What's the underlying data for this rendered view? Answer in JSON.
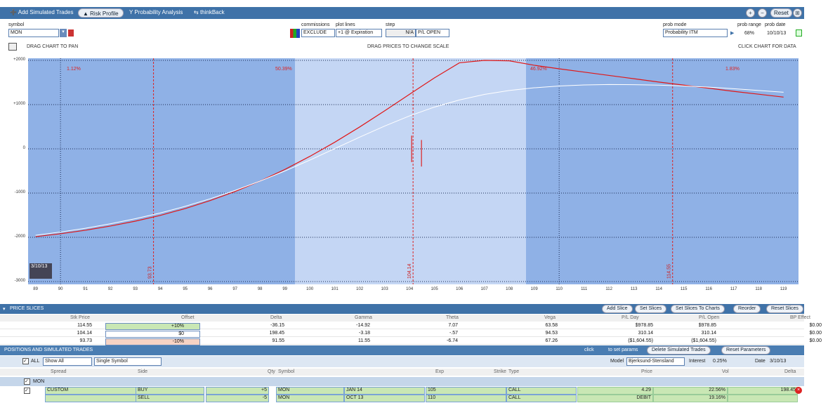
{
  "toolbar": {
    "add_simulated": "Add Simulated Trades",
    "risk_profile": "Risk Profile",
    "probability": "Probability Analysis",
    "thinkback": "thinkBack",
    "reset": "Reset"
  },
  "controls": {
    "symbol_label": "symbol",
    "symbol": "MON",
    "commissions_label": "commissions",
    "commissions": "EXCLUDE",
    "plot_lines_label": "plot lines",
    "plot_lines": "+1 @ Expiration",
    "step_label": "step",
    "step": "N/A",
    "pl_mode": "P/L OPEN",
    "prob_mode_label": "prob mode",
    "prob_mode": "Probability ITM",
    "prob_range_label": "prob range",
    "prob_range": "68%",
    "prob_date_label": "prob date",
    "prob_date": "10/10/13"
  },
  "hints": {
    "pan": "DRAG CHART TO PAN",
    "scale": "DRAG PRICES TO CHANGE SCALE",
    "data": "CLICK CHART FOR DATA"
  },
  "chart_data": {
    "type": "line",
    "x": [
      89,
      90,
      91,
      92,
      93,
      94,
      95,
      96,
      97,
      98,
      99,
      100,
      101,
      102,
      103,
      104,
      105,
      106,
      107,
      108,
      109,
      110,
      111,
      112,
      113,
      114,
      115,
      116,
      117,
      118,
      119
    ],
    "xlim": [
      88.7,
      119.6
    ],
    "ylim": [
      -3000,
      2000
    ],
    "series": [
      {
        "values": [
          -1985,
          -1920,
          -1840,
          -1745,
          -1635,
          -1505,
          -1350,
          -1170,
          -965,
          -730,
          -465,
          -170,
          150,
          495,
          860,
          1235,
          1605,
          1945,
          2000,
          1990,
          1890,
          1810,
          1735,
          1660,
          1585,
          1510,
          1440,
          1370,
          1300,
          1235,
          1170
        ],
        "color": "#e01818"
      },
      {
        "values": [
          -1955,
          -1880,
          -1795,
          -1695,
          -1580,
          -1450,
          -1300,
          -1130,
          -940,
          -730,
          -500,
          -255,
          5,
          265,
          515,
          745,
          945,
          1105,
          1230,
          1320,
          1380,
          1420,
          1445,
          1455,
          1450,
          1440,
          1420,
          1395,
          1360,
          1320,
          1280
        ],
        "color": "#ffffff"
      }
    ],
    "yticks": [
      "+2000",
      "+1000",
      "0",
      "-1000",
      "-2000",
      "-3000"
    ],
    "probabilities": [
      "1.12%",
      "50.39%",
      "46.92%",
      "1.83%"
    ],
    "slices": [
      "93.73",
      "104.14",
      "114.55"
    ],
    "date_label": "3/10/13"
  },
  "slices": {
    "title": "PRICE SLICES",
    "buttons": [
      "Add Slice",
      "Set Slices",
      "Set Slices To Charts",
      "Reorder",
      "Reset Slices"
    ],
    "headers": [
      "Stk Price",
      "Offset",
      "Delta",
      "Gamma",
      "Theta",
      "Vega",
      "P/L Day",
      "P/L Open",
      "BP Effect"
    ],
    "rows": [
      [
        "114.55",
        "+10%",
        "-36.15",
        "-14.92",
        "7.07",
        "63.58",
        "$978.85",
        "$978.85",
        "$0.00"
      ],
      [
        "104.14",
        "$0",
        "198.45",
        "-3.18",
        "-.57",
        "94.53",
        "310.14",
        "310.14",
        "$0.00"
      ],
      [
        "93.73",
        "-10%",
        "91.55",
        "11.55",
        "-6.74",
        "67.26",
        "($1,604.55)",
        "($1,604.55)",
        "$0.00"
      ]
    ]
  },
  "positions": {
    "title": "POSITIONS AND SIMULATED TRADES",
    "click_hint": "click",
    "set_params": "to set params",
    "delete_btn": "Delete Simulated Trades",
    "reset_btn": "Reset Parameters",
    "all_label": "ALL",
    "show": "Show All",
    "symbol_mode": "Single Symbol",
    "model_label": "Model",
    "model": "Bjerksund-Stensland",
    "interest_label": "Interest",
    "interest": "0.25%",
    "date_label": "Date",
    "date": "3/10/13",
    "headers": [
      "Spread",
      "Side",
      "Qty",
      "Symbol",
      "Exp",
      "Strike",
      "Type",
      "Price",
      "Vol",
      "Delta"
    ],
    "group": "MON",
    "legs": [
      {
        "spread": "CUSTOM",
        "side": "BUY",
        "qty": "+5",
        "symbol": "MON",
        "exp": "JAN 14",
        "strike": "105",
        "type": "CALL",
        "price": "4.29",
        "vol": "22.56%",
        "delta": "198.45"
      },
      {
        "spread": "",
        "side": "SELL",
        "qty": "-5",
        "symbol": "MON",
        "exp": "OCT 13",
        "strike": "110",
        "type": "CALL",
        "price": "DEBIT",
        "vol": "19.16%",
        "delta": ""
      }
    ]
  }
}
